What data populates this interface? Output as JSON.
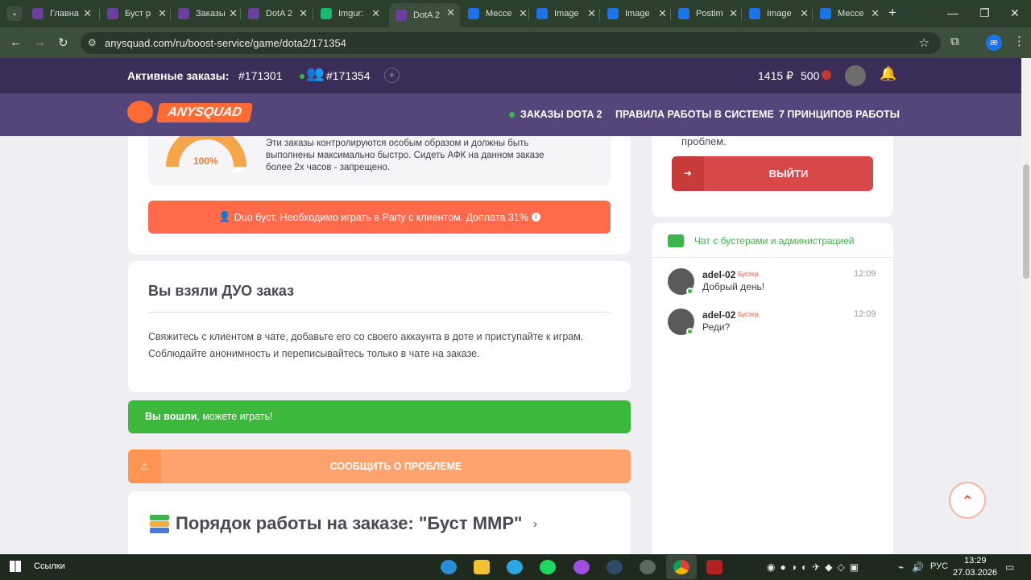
{
  "browser": {
    "tabs": [
      {
        "label": "Главна",
        "color": "#6b3fa0"
      },
      {
        "label": "Буст р",
        "color": "#6b3fa0"
      },
      {
        "label": "Заказы",
        "color": "#6b3fa0"
      },
      {
        "label": "DotA 2",
        "color": "#6b3fa0"
      },
      {
        "label": "Imgur:",
        "color": "#1bb76e"
      },
      {
        "label": "DotA 2",
        "color": "#6b3fa0",
        "active": true
      },
      {
        "label": "Мессе",
        "color": "#1a73e8"
      },
      {
        "label": "Image",
        "color": "#1a73e8"
      },
      {
        "label": "Image",
        "color": "#1a73e8"
      },
      {
        "label": "Postim",
        "color": "#1a73e8"
      },
      {
        "label": "Image",
        "color": "#1a73e8"
      },
      {
        "label": "Мессе",
        "color": "#1a73e8"
      }
    ],
    "url": "anysquad.com/ru/boost-service/game/dota2/171354",
    "new_tab": "+",
    "profile_initial": "æ"
  },
  "site": {
    "active_orders_label": "Активные заказы:",
    "order_a": "#171301",
    "order_b": "#171354",
    "balance": "1415 ₽",
    "points": "500",
    "logo_text": "ANYSQUAD",
    "nav": [
      "ЗАКАЗЫ DOTA 2",
      "ПРАВИЛА РАБОТЫ В СИСТЕМЕ",
      "7 ПРИНЦИПОВ РАБОТЫ"
    ],
    "accent": "#ff6b35",
    "header_dark": "#3a2e58",
    "header_nav": "#54457a"
  },
  "order": {
    "gauge_label": "100%",
    "gauge_fraction": 1.0,
    "info_text": "Эти заказы контролируются особым образом и должны быть выполнены максимально быстро. Сидеть АФК на данном заказе более 2х часов - запрещено.",
    "duo_banner": "Duo буст. Необходимо играть в Party с клиентом. Доплата 31%",
    "duo_title": "Вы взяли ДУО заказ",
    "duo_text": "Свяжитесь с клиентом в чате, добавьте его со своего аккаунта в доте и приступайте к играм. Соблюдайте анонимность и переписывайтесь только в чате на заказе.",
    "status_bold": "Вы вошли",
    "status_rest": ", можете играть!",
    "report_button": "СООБЩИТЬ О ПРОБЛЕМЕ",
    "procedure_title": "Порядок работы на заказе: \"Буст ММР\""
  },
  "sidebar": {
    "partial_text": "проблем.",
    "exit_button": "ВЫЙТИ",
    "chat_title": "Чат с бустерами и администрацией",
    "messages": [
      {
        "user": "adel-02",
        "role": "Бустер",
        "time": "12:09",
        "text": "Добрый день!"
      },
      {
        "user": "adel-02",
        "role": "Бустер",
        "time": "12:09",
        "text": "Реди?"
      }
    ]
  },
  "taskbar": {
    "search_label": "Ссылки",
    "lang": "РУС",
    "time": "13:29",
    "date": "27.03.2026"
  }
}
